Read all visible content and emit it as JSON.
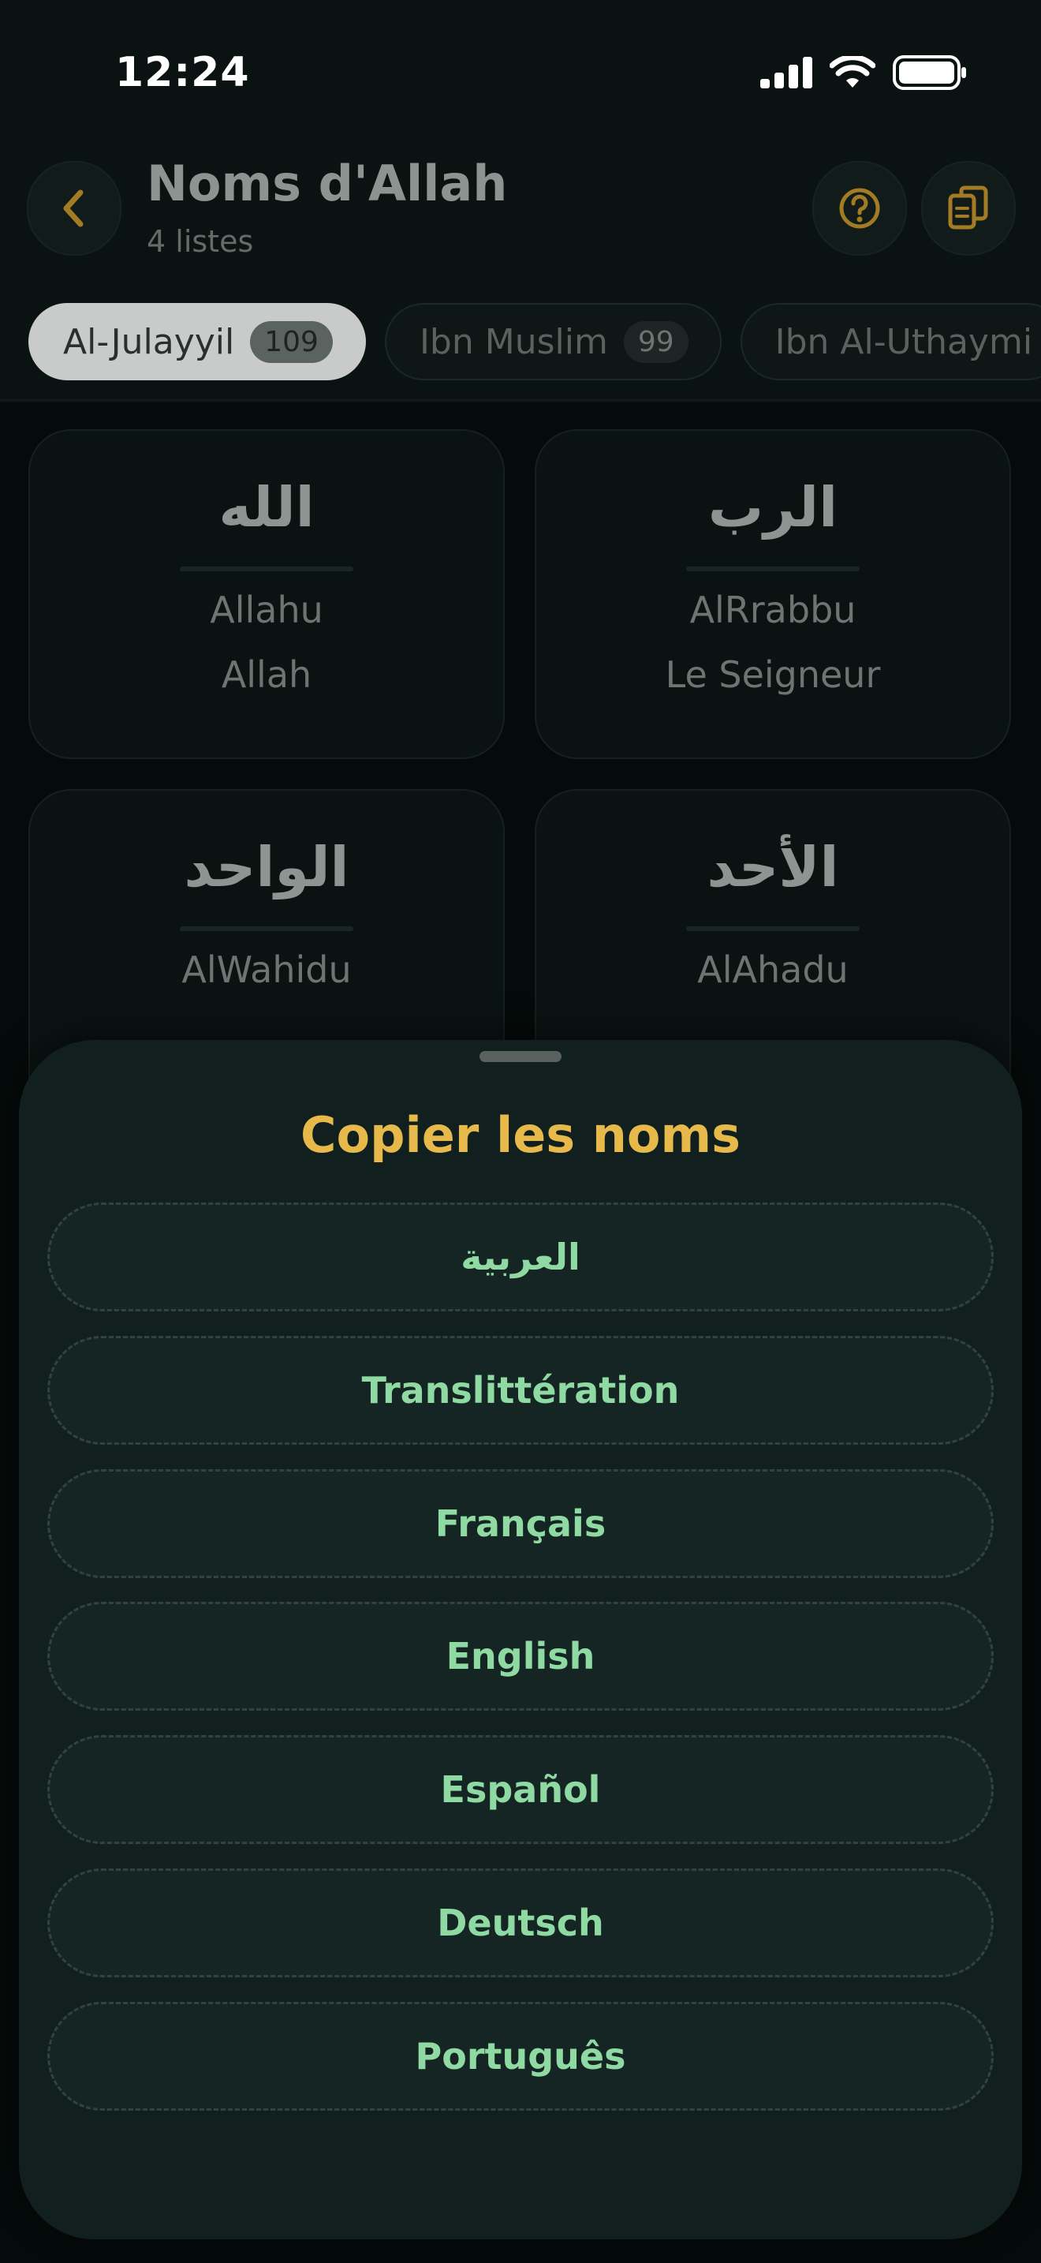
{
  "status_bar": {
    "time": "12:24"
  },
  "header": {
    "title": "Noms d'Allah",
    "subtitle": "4 listes",
    "back_icon": "chevron-left-icon",
    "help_icon": "question-circle-icon",
    "copy_icon": "copy-icon"
  },
  "chips": [
    {
      "label": "Al-Julayyil",
      "count": "109",
      "active": true
    },
    {
      "label": "Ibn Muslim",
      "count": "99",
      "active": false
    },
    {
      "label": "Ibn Al-Uthaymi",
      "count": "",
      "active": false
    }
  ],
  "names": [
    {
      "arabic": "الله",
      "translit": "Allahu",
      "french": "Allah"
    },
    {
      "arabic": "الرب",
      "translit": "AlRrabbu",
      "french": "Le Seigneur"
    },
    {
      "arabic": "الواحد",
      "translit": "AlWahidu",
      "french": ""
    },
    {
      "arabic": "الأحد",
      "translit": "AlAhadu",
      "french": ""
    }
  ],
  "sheet": {
    "title": "Copier les noms",
    "options": [
      "العربية",
      "Translittération",
      "Français",
      "English",
      "Español",
      "Deutsch",
      "Português"
    ]
  },
  "colors": {
    "accent_gold": "#e6b94a",
    "option_text": "#8fd9a3",
    "sheet_bg": "#11201e"
  }
}
